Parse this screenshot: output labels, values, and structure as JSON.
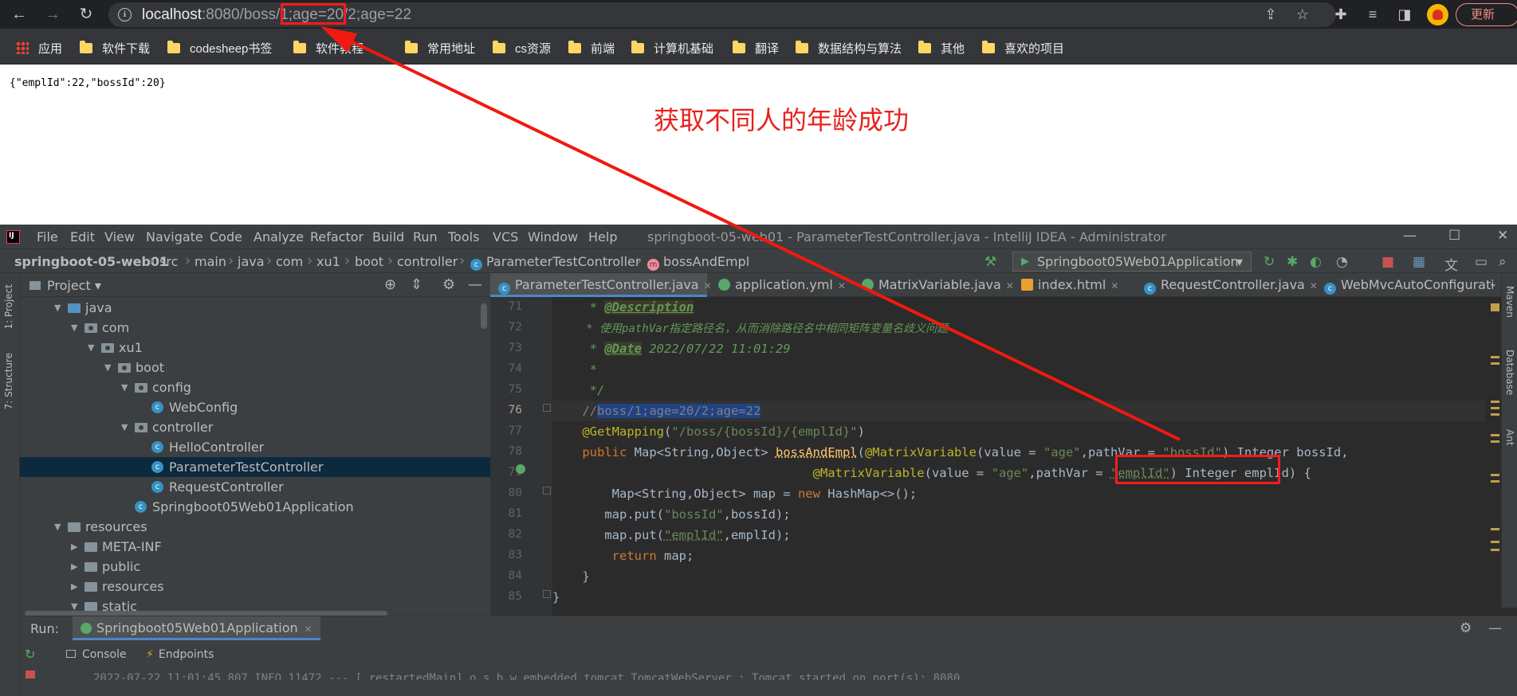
{
  "browser": {
    "url_host": "localhost",
    "url_rest": ":8080/boss/1;age=20/2;age=22",
    "update_label": "更新",
    "bookmarks": [
      "应用",
      "软件下载",
      "codesheep书签",
      "软件教程",
      "常用地址",
      "cs资源",
      "前端",
      "计算机基础",
      "翻译",
      "数据结构与算法",
      "其他",
      "喜欢的项目"
    ]
  },
  "page": {
    "json_output": "{\"emplId\":22,\"bossId\":20}",
    "annotation": "获取不同人的年龄成功"
  },
  "ide": {
    "window_title": "springboot-05-web01 - ParameterTestController.java - IntelliJ IDEA - Administrator",
    "menu": [
      "File",
      "Edit",
      "View",
      "Navigate",
      "Code",
      "Analyze",
      "Refactor",
      "Build",
      "Run",
      "Tools",
      "VCS",
      "Window",
      "Help"
    ],
    "breadcrumbs": [
      "springboot-05-web01",
      "src",
      "main",
      "java",
      "com",
      "xu1",
      "boot",
      "controller",
      "ParameterTestController",
      "bossAndEmpl"
    ],
    "run_config": "Springboot05Web01Application",
    "left_tabs": [
      "1: Project",
      "7: Structure"
    ],
    "right_tabs": [
      "Maven",
      "Database",
      "Ant"
    ],
    "project": {
      "title": "Project",
      "tree": [
        {
          "label": "java",
          "indent": 1,
          "arrow": "▼",
          "icon": "src"
        },
        {
          "label": "com",
          "indent": 2,
          "arrow": "▼",
          "icon": "pkg"
        },
        {
          "label": "xu1",
          "indent": 3,
          "arrow": "▼",
          "icon": "pkg"
        },
        {
          "label": "boot",
          "indent": 4,
          "arrow": "▼",
          "icon": "pkg"
        },
        {
          "label": "config",
          "indent": 5,
          "arrow": "▼",
          "icon": "pkg"
        },
        {
          "label": "WebConfig",
          "indent": 6,
          "arrow": "",
          "icon": "class"
        },
        {
          "label": "controller",
          "indent": 5,
          "arrow": "▼",
          "icon": "pkg"
        },
        {
          "label": "HelloController",
          "indent": 6,
          "arrow": "",
          "icon": "class"
        },
        {
          "label": "ParameterTestController",
          "indent": 6,
          "arrow": "",
          "icon": "class",
          "selected": true
        },
        {
          "label": "RequestController",
          "indent": 6,
          "arrow": "",
          "icon": "class"
        },
        {
          "label": "Springboot05Web01Application",
          "indent": 5,
          "arrow": "",
          "icon": "class"
        },
        {
          "label": "resources",
          "indent": 1,
          "arrow": "▼",
          "icon": "folder"
        },
        {
          "label": "META-INF",
          "indent": 2,
          "arrow": "▶",
          "icon": "folder"
        },
        {
          "label": "public",
          "indent": 2,
          "arrow": "▶",
          "icon": "folder"
        },
        {
          "label": "resources",
          "indent": 2,
          "arrow": "▶",
          "icon": "folder"
        },
        {
          "label": "static",
          "indent": 2,
          "arrow": "▼",
          "icon": "folder"
        }
      ]
    },
    "tabs": [
      {
        "label": "ParameterTestController.java",
        "icon": "c",
        "active": true
      },
      {
        "label": "application.yml",
        "icon": "y"
      },
      {
        "label": "MatrixVariable.java",
        "icon": "y"
      },
      {
        "label": "index.html",
        "icon": "h"
      },
      {
        "label": "RequestController.java",
        "icon": "c"
      },
      {
        "label": "WebMvcAutoConfiguratio",
        "icon": "c"
      }
    ],
    "line_numbers": [
      "71",
      "72",
      "73",
      "74",
      "75",
      "76",
      "77",
      "78",
      "79",
      "80",
      "81",
      "82",
      "83",
      "84",
      "85"
    ],
    "code": {
      "l71_star": "     * ",
      "l71_tag": "@Description",
      "l72": "     * 使用pathVar指定路径名，从而消除路径名中相同矩阵变量名歧义问题",
      "l73_star": "     * ",
      "l73_tag": "@Date",
      "l73_rest": " 2022/07/22 11:01:29",
      "l74": "     *",
      "l75": "     */",
      "l76_pre": "    //",
      "l76_sel": "boss/1;age=20/2;age=22",
      "l77_ann": "    @GetMapping",
      "l77_p1": "(",
      "l77_str": "\"/boss/{bossId}/{emplId}\"",
      "l77_p2": ")",
      "l78_kw": "    public ",
      "l78_t1": "Map<String,Object> ",
      "l78_fn": "bossAndEmpl",
      "l78_p1": "(",
      "l78_ann": "@MatrixVariable",
      "l78_p2": "(value = ",
      "l78_s1": "\"age\"",
      "l78_p3": ",pathVar = ",
      "l78_s2": "\"bossId\"",
      "l78_p4": ") Integer bossId,",
      "l79_ind": "                                   ",
      "l79_ann": "@MatrixVariable",
      "l79_p2": "(value = ",
      "l79_s1": "\"age\"",
      "l79_p3": ",pathVar = ",
      "l79_s2": "\"emplId\"",
      "l79_p4": ") Integer emplId) {",
      "l80_a": "        Map<String,Object> map = ",
      "l80_kw": "new ",
      "l80_b": "HashMap<>();",
      "l81_a": "       map.put(",
      "l81_s": "\"bossId\"",
      "l81_b": ",bossId);",
      "l82_a": "       map.put(",
      "l82_s": "\"emplId\"",
      "l82_b": ",emplId);",
      "l83_kw": "        return ",
      "l83_b": "map;",
      "l84": "    }",
      "l85": "}"
    },
    "run": {
      "label": "Run:",
      "tab": "Springboot05Web01Application",
      "console": "Console",
      "endpoints": "Endpoints",
      "log_line": "2022-07-22 11:01:45.807  INFO 11472 --- [  restartedMain] o.s.b.w.embedded.tomcat.TomcatWebServer  : Tomcat started on port(s): 8080"
    }
  },
  "colors": {
    "annotation_red": "#e8221d",
    "ide_background": "#2b2b2b",
    "ide_panel": "#3c3f41",
    "selection_blue": "#214283"
  }
}
